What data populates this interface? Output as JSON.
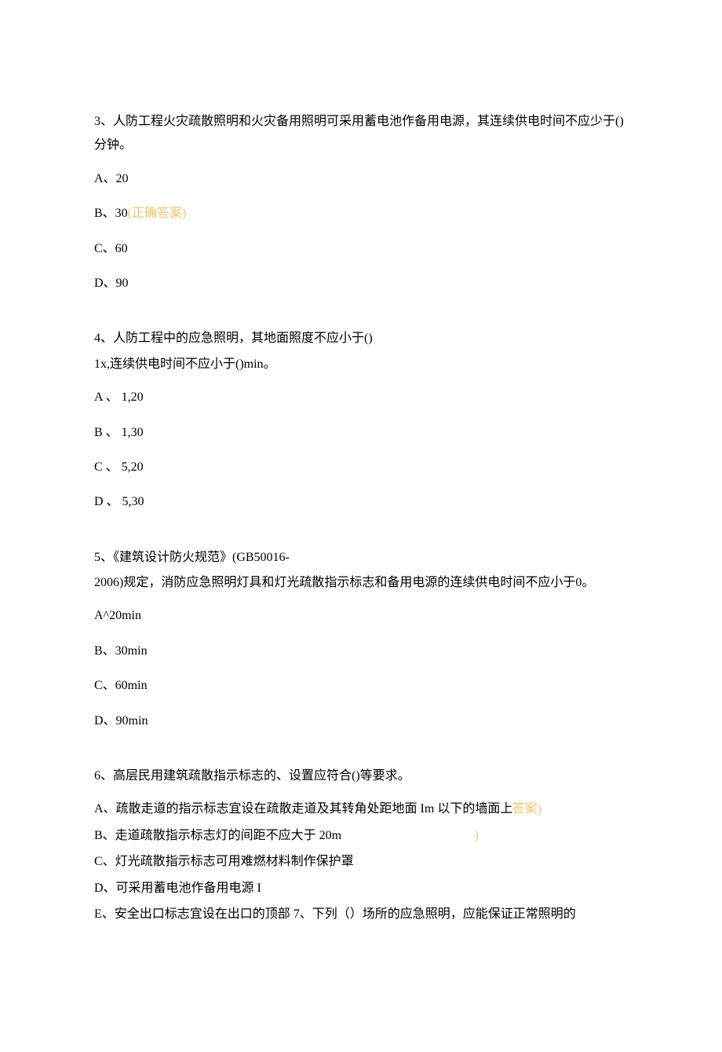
{
  "q3": {
    "text": "3、人防工程火灾疏散照明和火灾备用照明可采用蓄电池作备用电源，其连续供电时间不应少于()分钟。",
    "A": "A、20",
    "B_pre": "B、30",
    "B_correct": "(正确答案)",
    "C": "C、60",
    "D": "D、90"
  },
  "q4": {
    "line1": "4、人防工程中的应急照明，其地面照度不应小于()",
    "line2": "1x,连续供电时间不应小于()min。",
    "A": "A 、 1,20",
    "B": "B 、 1,30",
    "C": "C 、 5,20",
    "D": "D 、 5,30"
  },
  "q5": {
    "line1": "5、《建筑设计防火规范》(GB50016-",
    "line2": "2006)规定，消防应急照明灯具和灯光疏散指示标志和备用电源的连续供电时间不应小于0。",
    "A": "A^20min",
    "B": "B、30min",
    "C": "C、60min",
    "D": "D、90min"
  },
  "q6": {
    "text": "6、高层民用建筑疏散指示标志的、设置应符合()等要求。",
    "A_pre": "A、疏散走道的指示标志宜设在疏散走道及其转角处距地面 Im 以下的墙面上",
    "A_tail": "答案)",
    "B_pre": "B、走道疏散指示标志灯的间距不应大于 20m",
    "B_tail": ")",
    "C": "C、灯光疏散指示标志可用难燃材料制作保护罩",
    "D": "D、可采用蓄电池作备用电源 I",
    "E": "E、安全出口标志宜设在出口的顶部 7、下列（）场所的应急照明，应能保证正常照明的"
  }
}
